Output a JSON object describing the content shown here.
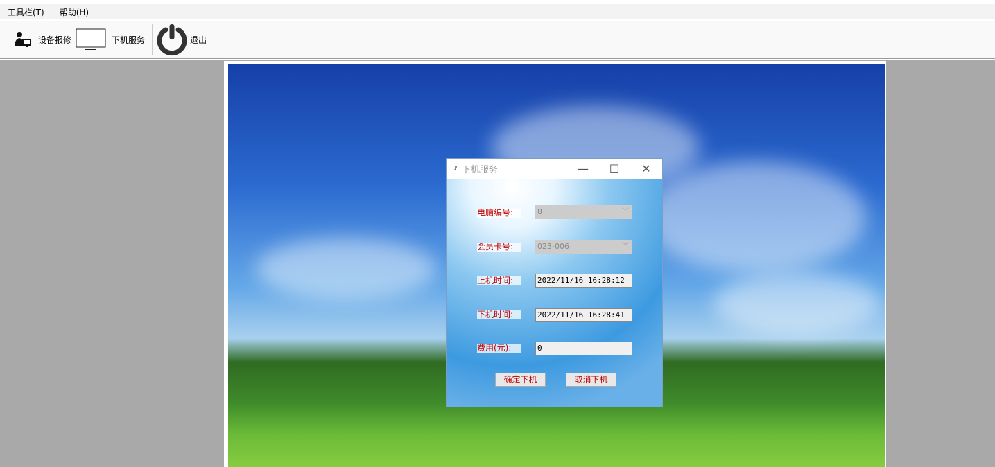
{
  "menu": {
    "toolbar": "工具栏(T)",
    "help": "帮助(H)"
  },
  "toolbar": {
    "repair": "设备报修",
    "logout_service": "下机服务",
    "exit": "退出"
  },
  "dialog": {
    "title": "下机服务",
    "fields": [
      {
        "label": "电脑编号:",
        "value": "8"
      },
      {
        "label": "会员卡号:",
        "value": "023-006"
      },
      {
        "label": "上机时间:",
        "value": "2022/11/16 16:28:12"
      },
      {
        "label": "下机时间:",
        "value": "2022/11/16 16:28:41"
      },
      {
        "label": "费用(元):",
        "value": "0"
      }
    ],
    "confirm": "确定下机",
    "cancel": "取消下机"
  }
}
